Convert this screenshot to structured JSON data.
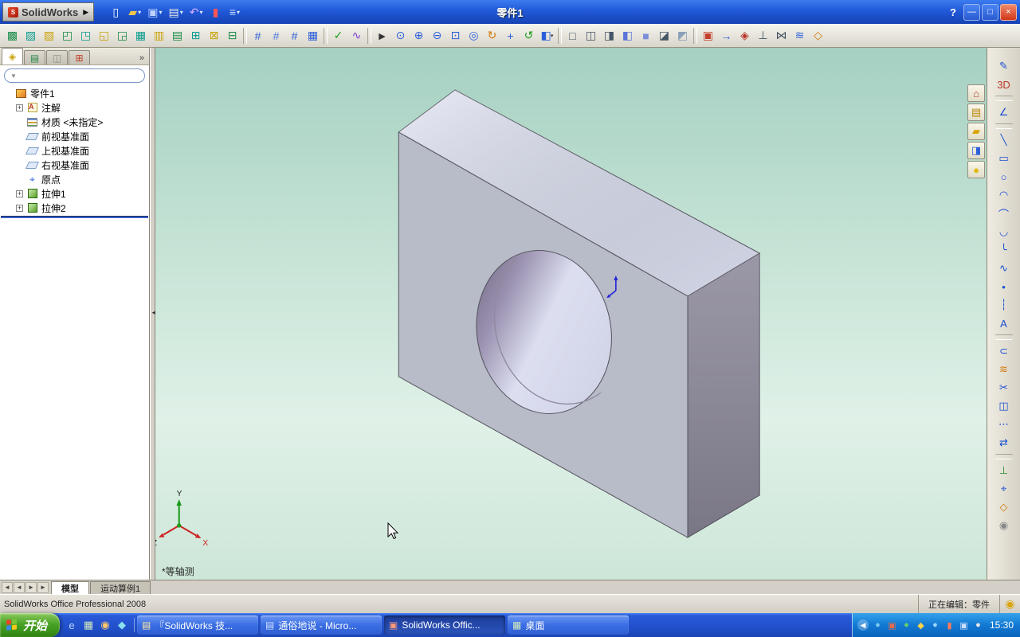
{
  "ui": {
    "dropdown_glyph": "▾",
    "expander_glyph": "+",
    "chevron_glyph": "»",
    "filter_icon_glyph": "▼",
    "splitter_glyph": "◄",
    "brand_arrow_glyph": "▶",
    "logo_glyph": "S",
    "tray_chevron": "◀"
  },
  "titlebar": {
    "brand": "SolidWorks",
    "title": "零件1",
    "help": "?",
    "icons": [
      {
        "name": "new-document-icon",
        "glyph": "▯",
        "fg": "#ffffff"
      },
      {
        "name": "open-icon",
        "glyph": "▰",
        "fg": "#f7c64a",
        "dd": true
      },
      {
        "name": "save-icon",
        "glyph": "▣",
        "fg": "#bcd2ff",
        "dd": true
      },
      {
        "name": "print-icon",
        "glyph": "▤",
        "fg": "#e8e8e8",
        "dd": true
      },
      {
        "name": "undo-icon",
        "glyph": "↶",
        "fg": "#d9b3ff",
        "dd": true
      },
      {
        "name": "rebuild-icon",
        "glyph": "▮",
        "fg": "#ff5555"
      },
      {
        "name": "options-icon",
        "glyph": "≡",
        "fg": "#cfe0ff",
        "dd": true
      }
    ],
    "window_buttons": [
      {
        "name": "minimize-button",
        "glyph": "—"
      },
      {
        "name": "maximize-button",
        "glyph": "□"
      },
      {
        "name": "close-button",
        "glyph": "×"
      }
    ]
  },
  "main_toolbar": [
    {
      "name": "sketch-icon",
      "glyph": "▩",
      "fg": "#1a8c4a"
    },
    {
      "name": "sketch-edit-icon",
      "glyph": "▨",
      "fg": "#0a9d8f"
    },
    {
      "name": "extrude-boss-icon",
      "glyph": "▧",
      "fg": "#c9a20a"
    },
    {
      "name": "revolve-icon",
      "glyph": "◰",
      "fg": "#1a8c4a"
    },
    {
      "name": "swept-icon",
      "glyph": "◳",
      "fg": "#0a9d8f"
    },
    {
      "name": "loft-icon",
      "glyph": "◱",
      "fg": "#c9a20a"
    },
    {
      "name": "cut-icon",
      "glyph": "◲",
      "fg": "#1a8c4a"
    },
    {
      "name": "fillet-icon",
      "glyph": "▦",
      "fg": "#0a9d8f"
    },
    {
      "name": "chamfer-icon",
      "glyph": "▥",
      "fg": "#c9a20a"
    },
    {
      "name": "rib-icon",
      "glyph": "▤",
      "fg": "#1a8c4a"
    },
    {
      "name": "shell-icon",
      "glyph": "⊞",
      "fg": "#0a9d8f"
    },
    {
      "name": "draft-icon",
      "glyph": "⊠",
      "fg": "#c9a20a"
    },
    {
      "name": "hole-wizard-icon",
      "glyph": "⊟",
      "fg": "#1a8c4a"
    },
    {
      "sep": true
    },
    {
      "name": "linear-pattern-icon",
      "glyph": "#",
      "fg": "#2b5fd9"
    },
    {
      "name": "circular-pattern-icon",
      "glyph": "#",
      "fg": "#4a7ae0"
    },
    {
      "name": "mirror-pattern-icon",
      "glyph": "#",
      "fg": "#2b5fd9"
    },
    {
      "name": "reference-geometry-icon",
      "glyph": "▦",
      "fg": "#2b5fd9"
    },
    {
      "sep": true
    },
    {
      "name": "curves-icon",
      "glyph": "✓",
      "fg": "#1a9d1a"
    },
    {
      "name": "instant3d-icon",
      "glyph": "∿",
      "fg": "#7a3fd1"
    },
    {
      "sep": true
    },
    {
      "name": "select-icon",
      "glyph": "►",
      "fg": "#333333"
    },
    {
      "name": "zoom-previous-icon",
      "glyph": "⊙",
      "fg": "#2b5fd9"
    },
    {
      "name": "zoom-in-icon",
      "glyph": "⊕",
      "fg": "#2b5fd9"
    },
    {
      "name": "zoom-out-icon",
      "glyph": "⊖",
      "fg": "#2b5fd9"
    },
    {
      "name": "zoom-area-icon",
      "glyph": "⊡",
      "fg": "#2b5fd9"
    },
    {
      "name": "zoom-fit-icon",
      "glyph": "◎",
      "fg": "#2b5fd9"
    },
    {
      "name": "rotate-view-icon",
      "glyph": "↻",
      "fg": "#d17a0a"
    },
    {
      "name": "pan-icon",
      "glyph": "+",
      "fg": "#2b5fd9"
    },
    {
      "name": "refresh-icon",
      "glyph": "↺",
      "fg": "#1a9d1a"
    },
    {
      "name": "standard-views-icon",
      "glyph": "◧",
      "fg": "#2b5fd9",
      "dd": true
    },
    {
      "sep": true
    },
    {
      "name": "wireframe-icon",
      "glyph": "□",
      "fg": "#445566"
    },
    {
      "name": "hidden-lines-visible-icon",
      "glyph": "◫",
      "fg": "#445566"
    },
    {
      "name": "hidden-lines-removed-icon",
      "glyph": "◨",
      "fg": "#445566"
    },
    {
      "name": "shaded-with-edges-icon",
      "glyph": "◧",
      "fg": "#5a74d8"
    },
    {
      "name": "shaded-icon",
      "glyph": "■",
      "fg": "#7a8fd8"
    },
    {
      "name": "shadows-icon",
      "glyph": "◪",
      "fg": "#445566"
    },
    {
      "name": "section-view-icon",
      "glyph": "◩",
      "fg": "#8aa0b8"
    },
    {
      "sep": true
    },
    {
      "name": "view-orientation-icon",
      "glyph": "▣",
      "fg": "#c2402a"
    },
    {
      "name": "camera-icon",
      "glyph": "→",
      "fg": "#2b5fd9"
    },
    {
      "name": "appearance-icon",
      "glyph": "◈",
      "fg": "#b8362a"
    },
    {
      "name": "scene-icon",
      "glyph": "⊥",
      "fg": "#445566"
    },
    {
      "name": "measure-icon",
      "glyph": "⋈",
      "fg": "#445566"
    },
    {
      "name": "mass-properties-icon",
      "glyph": "≋",
      "fg": "#2b5fd9"
    },
    {
      "name": "toolbar-options-icon",
      "glyph": "◇",
      "fg": "#d17a0a"
    }
  ],
  "left_panel": {
    "tabs": [
      {
        "name": "featuremanager-tab",
        "glyph": "◈",
        "fg": "#caa20a",
        "active": true
      },
      {
        "name": "propertymanager-tab",
        "glyph": "▤",
        "fg": "#2b8a4a"
      },
      {
        "name": "configurationmanager-tab",
        "glyph": "◫",
        "fg": "#888888"
      },
      {
        "name": "dimxpert-tab",
        "glyph": "⊞",
        "fg": "#c2402a"
      }
    ],
    "filter_value": "",
    "tree": [
      {
        "label": "零件1",
        "icon": "part-icon",
        "level": 0
      },
      {
        "label": "注解",
        "icon": "annotations-icon",
        "level": 1,
        "expandable": true
      },
      {
        "label": "材质 <未指定>",
        "icon": "material-icon",
        "level": 1
      },
      {
        "label": "前视基准面",
        "icon": "plane-icon",
        "level": 1
      },
      {
        "label": "上视基准面",
        "icon": "plane-icon",
        "level": 1
      },
      {
        "label": "右视基准面",
        "icon": "plane-icon",
        "level": 1
      },
      {
        "label": "原点",
        "icon": "origin-icon",
        "level": 1
      },
      {
        "label": "拉伸1",
        "icon": "extrude-icon",
        "level": 1,
        "expandable": true
      },
      {
        "label": "拉伸2",
        "icon": "extrude-icon",
        "level": 1,
        "expandable": true
      }
    ]
  },
  "viewport": {
    "view_label": "*等轴测",
    "triad": {
      "x_label": "X",
      "y_label": "Y",
      "z_label": "Z"
    },
    "model": {
      "top_color": "#dde1f2",
      "front_color": "#b8bbc8",
      "side_color": "#8d899b",
      "hole_dark": "#6e6880",
      "hole_light": "#dcdff0",
      "edge_color": "#55545e"
    }
  },
  "task_pane_tabs": [
    {
      "name": "solidworks-resources-icon",
      "glyph": "⌂",
      "fg": "#b8362a"
    },
    {
      "name": "design-library-icon",
      "glyph": "▤",
      "fg": "#b8860b"
    },
    {
      "name": "file-explorer-icon",
      "glyph": "▰",
      "fg": "#d9a40a"
    },
    {
      "name": "palette-icon",
      "glyph": "◨",
      "fg": "#2b5fd9"
    },
    {
      "name": "appearances-icon",
      "glyph": "●",
      "fg": "#e0b80a"
    }
  ],
  "right_toolbar": [
    {
      "name": "sketch-icon",
      "glyph": "✎",
      "fg": "#1a4fd1"
    },
    {
      "name": "3d-sketch-icon",
      "glyph": "3D",
      "fg": "#b8362a"
    },
    {
      "sep": true
    },
    {
      "name": "smart-dimension-icon",
      "glyph": "∠",
      "fg": "#1a4fd1"
    },
    {
      "sep": true
    },
    {
      "name": "line-icon",
      "glyph": "╲",
      "fg": "#1a4fd1"
    },
    {
      "name": "rectangle-icon",
      "glyph": "▭",
      "fg": "#1a4fd1"
    },
    {
      "name": "circle-icon",
      "glyph": "○",
      "fg": "#1a4fd1"
    },
    {
      "name": "centerpoint-arc-icon",
      "glyph": "◠",
      "fg": "#1a4fd1"
    },
    {
      "name": "tangent-arc-icon",
      "glyph": "⌒",
      "fg": "#1a4fd1"
    },
    {
      "name": "3-point-arc-icon",
      "glyph": "◡",
      "fg": "#1a4fd1"
    },
    {
      "name": "sketch-fillet-icon",
      "glyph": "╰",
      "fg": "#1a4fd1"
    },
    {
      "name": "spline-icon",
      "glyph": "∿",
      "fg": "#1a4fd1"
    },
    {
      "name": "point-icon",
      "glyph": "•",
      "fg": "#1a4fd1"
    },
    {
      "name": "centerline-icon",
      "glyph": "┆",
      "fg": "#1a4fd1"
    },
    {
      "name": "text-icon",
      "glyph": "A",
      "fg": "#1a4fd1"
    },
    {
      "sep": true
    },
    {
      "name": "convert-entities-icon",
      "glyph": "⊂",
      "fg": "#1a4fd1"
    },
    {
      "name": "offset-entities-icon",
      "glyph": "≋",
      "fg": "#d17a0a"
    },
    {
      "name": "trim-entities-icon",
      "glyph": "✂",
      "fg": "#1a4fd1"
    },
    {
      "name": "mirror-entities-icon",
      "glyph": "◫",
      "fg": "#1a4fd1"
    },
    {
      "name": "linear-sketch-pattern-icon",
      "glyph": "⋯",
      "fg": "#1a4fd1"
    },
    {
      "name": "move-entities-icon",
      "glyph": "⇄",
      "fg": "#1a4fd1"
    },
    {
      "sep": true
    },
    {
      "name": "display-relations-icon",
      "glyph": "⊥",
      "fg": "#2a8a2a"
    },
    {
      "name": "repair-sketch-icon",
      "glyph": "⌖",
      "fg": "#1a4fd1"
    },
    {
      "name": "quick-snaps-icon",
      "glyph": "◇",
      "fg": "#d17a0a"
    },
    {
      "name": "rapid-sketch-icon",
      "glyph": "◉",
      "fg": "#888888"
    }
  ],
  "bottom": {
    "nav": [
      "◄",
      "◄",
      "►",
      "►"
    ],
    "tabs": [
      {
        "name": "model-tab",
        "label": "模型",
        "active": true
      },
      {
        "name": "motion-study-tab",
        "label": "运动算例1"
      }
    ]
  },
  "statusbar": {
    "left": "SolidWorks Office Professional 2008",
    "editing": "正在编辑：零件",
    "badge_glyph": "◉"
  },
  "taskbar": {
    "start_label": "开始",
    "quick_launch": [
      {
        "name": "ie-icon",
        "glyph": "e",
        "fg": "#bcd8ff"
      },
      {
        "name": "show-desktop-icon",
        "glyph": "▦",
        "fg": "#cfe8c0"
      },
      {
        "name": "media-player-icon",
        "glyph": "◉",
        "fg": "#ffc86a"
      },
      {
        "name": "messenger-icon",
        "glyph": "◆",
        "fg": "#8ae0f0"
      }
    ],
    "tasks": [
      {
        "name": "task-solidworks-doc",
        "icon_glyph": "▤",
        "fg": "#ffe8a0",
        "label": "『SolidWorks 技..."
      },
      {
        "name": "task-word-doc",
        "icon_glyph": "▤",
        "fg": "#cfe0ff",
        "label": "通俗地说 - Micro..."
      },
      {
        "name": "task-solidworks-app",
        "icon_glyph": "▣",
        "fg": "#ff9a7a",
        "label": "SolidWorks Offic...",
        "active": true
      },
      {
        "name": "task-desktop",
        "icon_glyph": "▦",
        "fg": "#cfe8c0",
        "label": "桌面"
      }
    ],
    "tray_icons": [
      {
        "name": "tray-network-icon",
        "glyph": "●",
        "fg": "#7ac8f0"
      },
      {
        "name": "tray-security-icon",
        "glyph": "▣",
        "fg": "#e86a4a"
      },
      {
        "name": "tray-update-icon",
        "glyph": "●",
        "fg": "#6ad06a"
      },
      {
        "name": "tray-volume-icon",
        "glyph": "◆",
        "fg": "#ffd24a"
      },
      {
        "name": "tray-im-icon",
        "glyph": "●",
        "fg": "#9ad8ff"
      },
      {
        "name": "tray-antivirus-icon",
        "glyph": "▮",
        "fg": "#ff7a5a"
      },
      {
        "name": "tray-input-icon",
        "glyph": "▣",
        "fg": "#cfe0ff"
      },
      {
        "name": "tray-battery-icon",
        "glyph": "●",
        "fg": "#e8e8e8"
      }
    ],
    "clock": "15:30"
  }
}
